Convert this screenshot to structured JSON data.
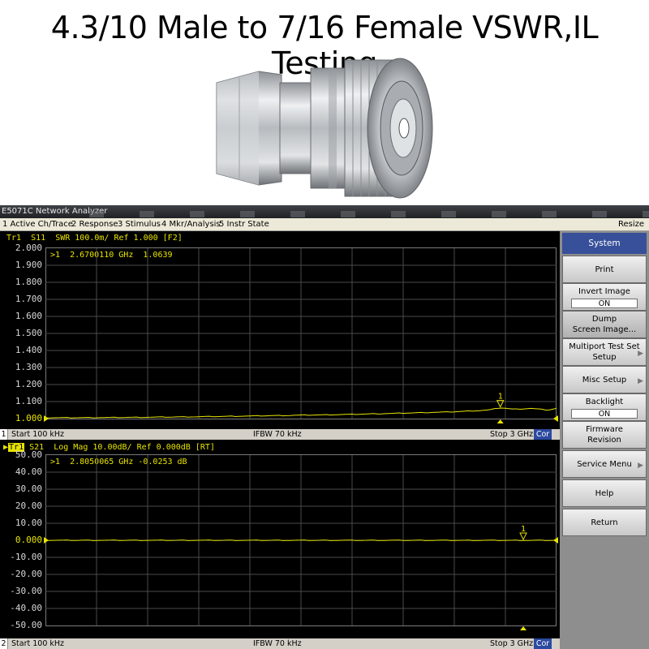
{
  "headline": "4.3/10 Male to 7/16 Female VSWR,IL Testing",
  "window": {
    "title": "E5071C Network Analyzer",
    "menu": [
      "1 Active Ch/Trace",
      "2 Response",
      "3 Stimulus",
      "4 Mkr/Analysis",
      "5 Instr State"
    ],
    "resize": "Resize"
  },
  "channel1": {
    "trace_header": "Tr1  S11  SWR 100.0m/ Ref 1.000 [F2]",
    "marker_readout": ">1  2.6700110 GHz  1.0639",
    "marker_label": "1",
    "status": {
      "channel": "1",
      "start": "Start 100 kHz",
      "ifbw": "IFBW 70 kHz",
      "stop": "Stop 3 GHz",
      "cor": "Cor"
    }
  },
  "channel2": {
    "trace_tag": "Tr1",
    "trace_header": "S21  Log Mag 10.00dB/ Ref 0.000dB [RT]",
    "marker_readout": ">1  2.8050065 GHz -0.0253 dB",
    "marker_label": "1",
    "status": {
      "channel": "2",
      "start": "Start 100 kHz",
      "ifbw": "IFBW 70 kHz",
      "stop": "Stop 3 GHz",
      "cor": "Cor"
    }
  },
  "softkeys": {
    "title": "System",
    "print": "Print",
    "invert_image": "Invert Image",
    "invert_image_value": "ON",
    "dump_1": "Dump",
    "dump_2": "Screen Image...",
    "multiport_1": "Multiport Test Set",
    "multiport_2": "Setup",
    "misc_setup": "Misc Setup",
    "backlight": "Backlight",
    "backlight_value": "ON",
    "firmware_1": "Firmware",
    "firmware_2": "Revision",
    "service_menu": "Service Menu",
    "help": "Help",
    "return": "Return"
  },
  "colors": {
    "trace": "#e8e400",
    "grid": "#4a4a4a",
    "softkey_title": "#38509a"
  },
  "chart_data": [
    {
      "type": "line",
      "title": "Tr1 S11 SWR 100.0m/ Ref 1.000 [F2]",
      "xlabel": "",
      "ylabel": "",
      "xlim": [
        0.0001,
        3
      ],
      "x_unit": "GHz",
      "ylim": [
        1.0,
        2.0
      ],
      "yticks": [
        "2.000",
        "1.900",
        "1.800",
        "1.700",
        "1.600",
        "1.500",
        "1.400",
        "1.300",
        "1.200",
        "1.100",
        "1.000"
      ],
      "grid": true,
      "series": [
        {
          "x": [
            0.0001,
            0.3,
            0.6,
            0.9,
            1.2,
            1.5,
            1.8,
            2.1,
            2.4,
            2.6,
            2.67,
            2.75,
            2.85,
            2.95,
            3.0
          ],
          "y": [
            1.005,
            1.006,
            1.008,
            1.011,
            1.015,
            1.02,
            1.025,
            1.032,
            1.04,
            1.05,
            1.0639,
            1.055,
            1.06,
            1.05,
            1.06
          ]
        }
      ],
      "marker": {
        "x": 2.67,
        "y": 1.0639
      }
    },
    {
      "type": "line",
      "title": "S21 Log Mag 10.00dB/ Ref 0.000dB [RT]",
      "xlabel": "",
      "ylabel": "",
      "xlim": [
        0.0001,
        3
      ],
      "x_unit": "GHz",
      "ylim": [
        -50,
        50
      ],
      "yticks": [
        "50.00",
        "40.00",
        "30.00",
        "20.00",
        "10.00",
        "0.000",
        "-10.00",
        "-20.00",
        "-30.00",
        "-40.00",
        "-50.00"
      ],
      "grid": true,
      "series": [
        {
          "x": [
            0.0001,
            0.5,
            1.0,
            1.5,
            2.0,
            2.5,
            2.805,
            3.0
          ],
          "y": [
            0.0,
            -0.005,
            -0.01,
            -0.012,
            -0.015,
            -0.02,
            -0.0253,
            -0.03
          ]
        }
      ],
      "marker": {
        "x": 2.805,
        "y": -0.0253
      }
    }
  ]
}
